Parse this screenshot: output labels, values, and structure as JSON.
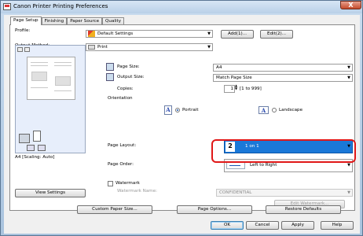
{
  "window": {
    "title": "Canon Printer Printing Preferences",
    "close_glyph": "X"
  },
  "tabs": [
    "Page Setup",
    "Finishing",
    "Paper Source",
    "Quality"
  ],
  "profile": {
    "label": "Profile:",
    "value": "Default Settings",
    "add_label": "Add(1)...",
    "edit_label": "Edit(2)..."
  },
  "output_method": {
    "label": "Output Method:",
    "value": "Print"
  },
  "preview": {
    "caption": "A4 [Scaling: Auto]",
    "view_settings_label": "View Settings"
  },
  "page_size": {
    "label": "Page Size:",
    "value": "A4"
  },
  "output_size": {
    "label": "Output Size:",
    "value": "Match Page Size"
  },
  "copies": {
    "label": "Copies:",
    "value": "1",
    "range": "[1 to 999]"
  },
  "orientation": {
    "label": "Orientation",
    "portrait_label": "Portrait",
    "landscape_label": "Landscape",
    "selected": "Portrait",
    "icon_glyph": "A"
  },
  "page_layout": {
    "label": "Page Layout:",
    "value": "1 on 1",
    "icon_glyph": "2"
  },
  "page_order": {
    "label": "Page Order:",
    "value": "Left to Right"
  },
  "watermark": {
    "label": "Watermark",
    "name_label": "Watermark Name:",
    "name_value": "CONFIDENTIAL",
    "edit_label": "Edit Watermark...",
    "checked": false
  },
  "bottom_buttons": {
    "custom_paper": "Custom Paper Size...",
    "page_options": "Page Options...",
    "restore": "Restore Defaults"
  },
  "dialog_buttons": {
    "ok": "OK",
    "cancel": "Cancel",
    "apply": "Apply",
    "help": "Help"
  },
  "colors": {
    "accent": "#1a78d8",
    "highlight": "#e01818",
    "preview_bg": "#e7eefb"
  }
}
